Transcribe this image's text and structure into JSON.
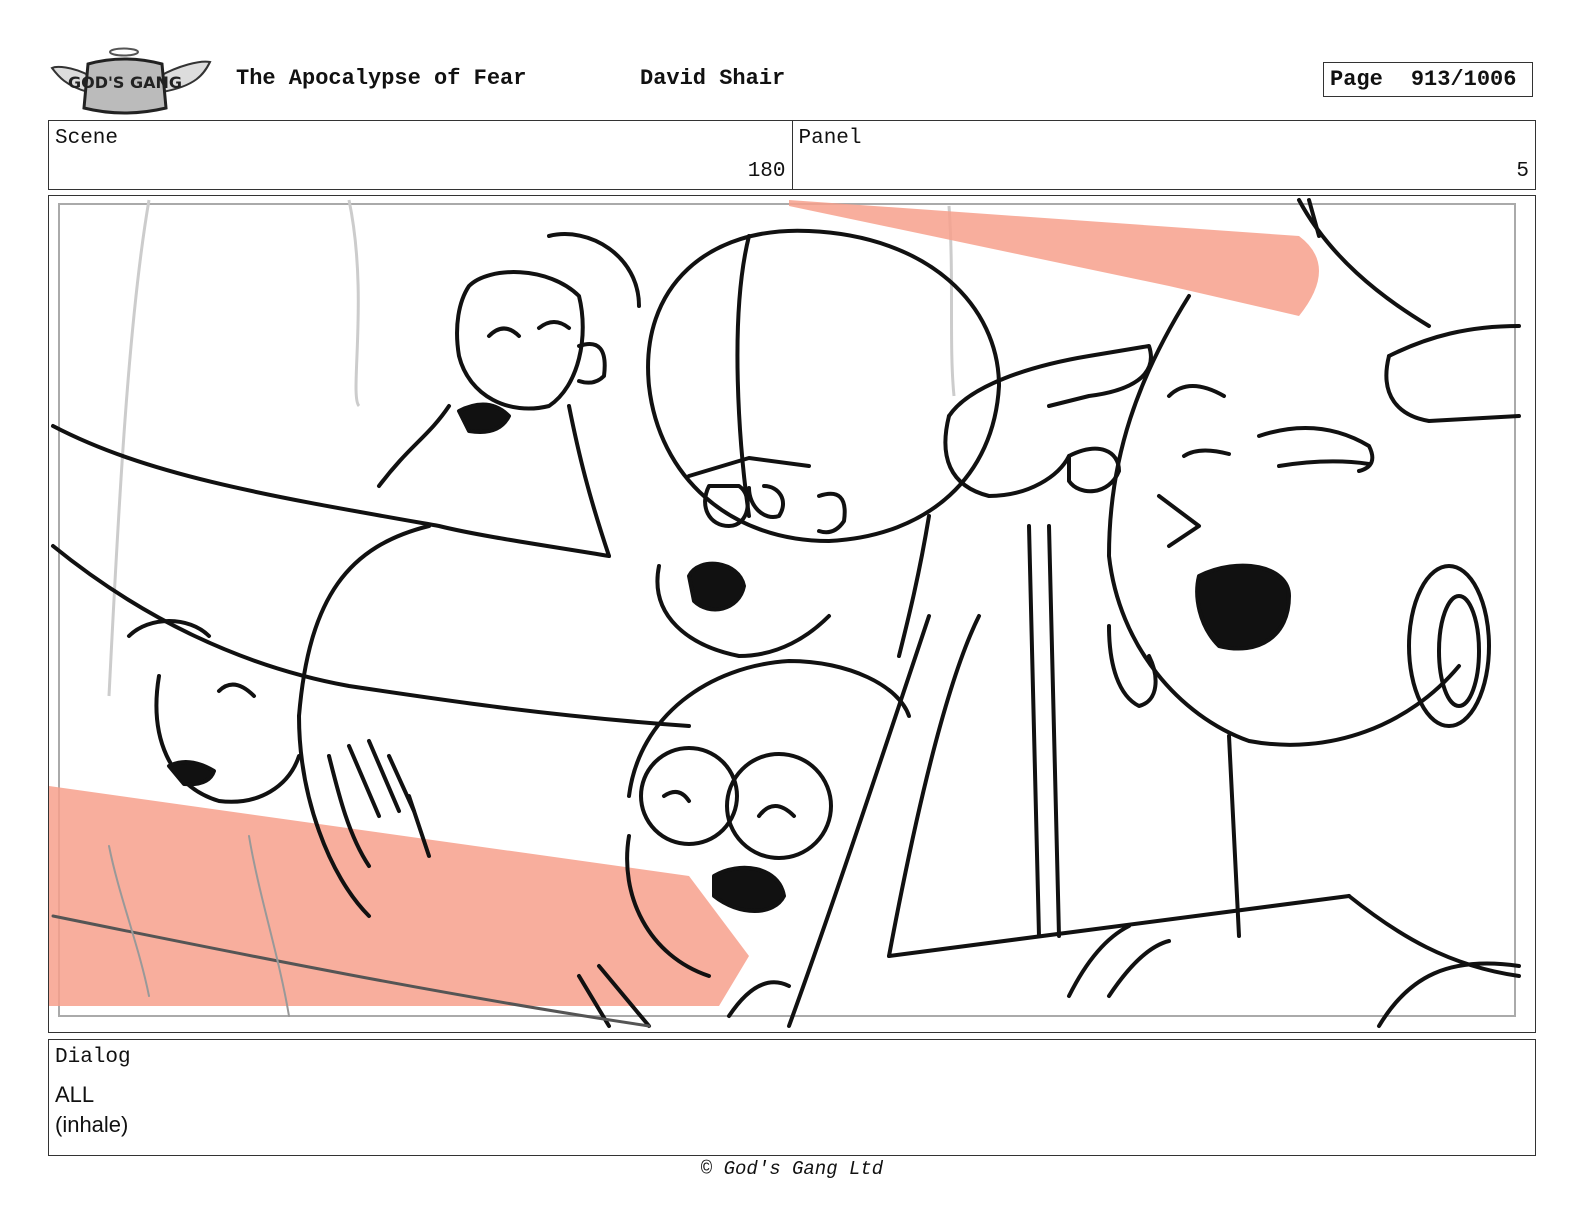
{
  "header": {
    "logo_text": "GOD'S GANG",
    "title": "The Apocalypse of Fear",
    "author": "David Shair",
    "page_label": "Page",
    "page_number": "913/1006"
  },
  "meta": {
    "scene_label": "Scene",
    "scene_value": "180",
    "panel_label": "Panel",
    "panel_value": "5"
  },
  "artwork": {
    "sketch_stroke": "#111111",
    "highlight_color": "#f7a08c"
  },
  "dialog": {
    "label": "Dialog",
    "lines": [
      "ALL",
      "(inhale)"
    ]
  },
  "footer": {
    "copyright": "© God's Gang Ltd"
  }
}
